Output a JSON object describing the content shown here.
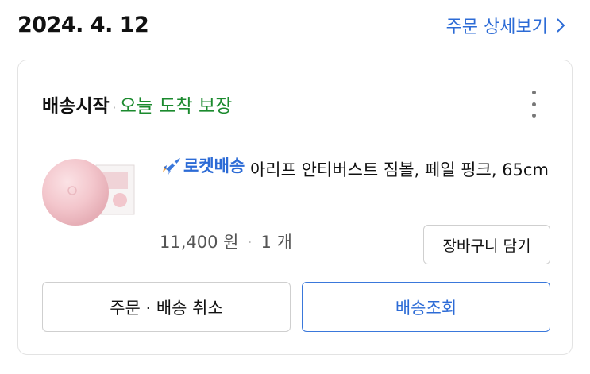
{
  "order": {
    "date": "2024. 4. 12",
    "detail_link_label": "주문 상세보기"
  },
  "shipment": {
    "status": "배송시작",
    "separator": "·",
    "guarantee": "오늘 도착 보장"
  },
  "product": {
    "badge_label": "로켓배송",
    "name": "아리프 안티버스트 짐볼, 페일 핑크, 65cm",
    "price": "11,400 원",
    "separator": "·",
    "quantity": "1 개"
  },
  "actions": {
    "add_to_cart": "장바구니 담기",
    "cancel": "주문 · 배송 취소",
    "track": "배송조회"
  },
  "icons": {
    "detail_chevron": "chevron-right-icon",
    "more": "more-vertical-icon",
    "badge": "rocket-icon",
    "thumbnail": "gym-ball-image"
  },
  "colors": {
    "accent": "#2c6bd6",
    "guarantee": "#1b8a2e",
    "product_pink": "#f3c9cf"
  }
}
